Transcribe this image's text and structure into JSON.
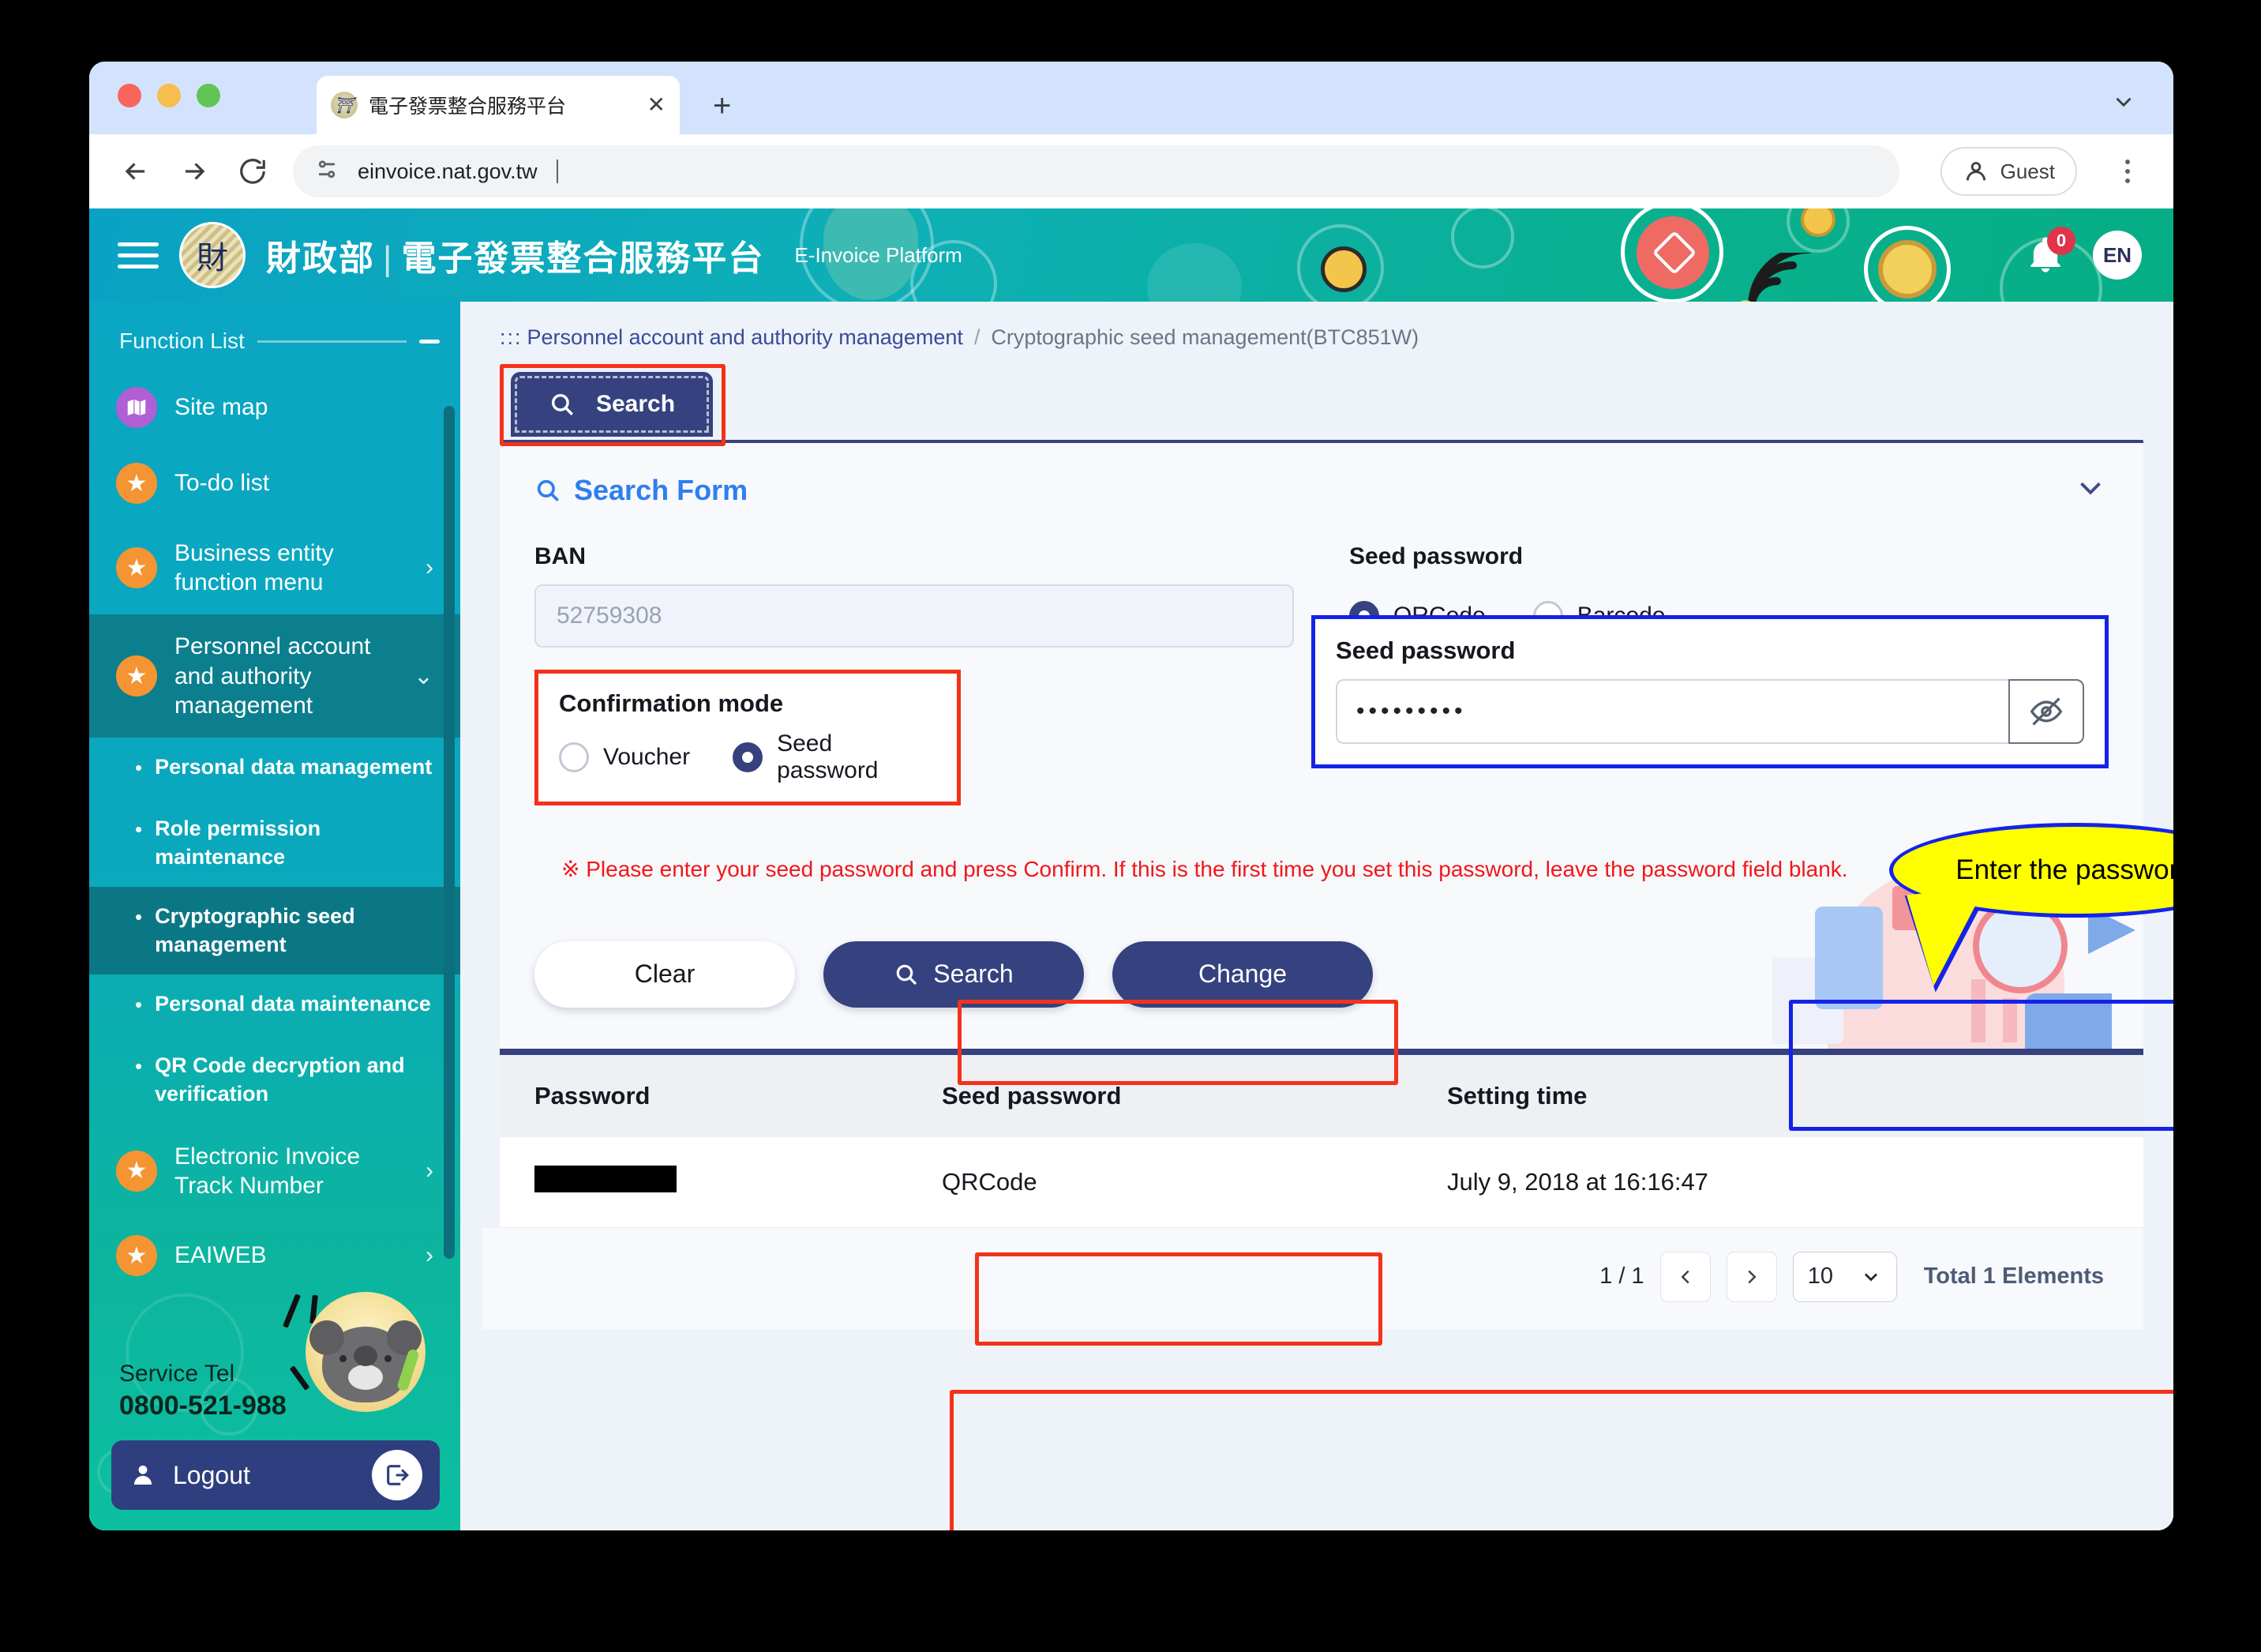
{
  "browser": {
    "tab_title": "電子發票整合服務平台",
    "tab_favicon": "mof-emblem-icon",
    "close_label": "✕",
    "newtab_label": "+",
    "url": "einvoice.nat.gov.tw",
    "guest_label": "Guest"
  },
  "header": {
    "brand_cn_left": "財政部",
    "brand_separator": "|",
    "brand_cn_right": "電子發票整合服務平台",
    "brand_en": "E-Invoice Platform",
    "notification_count": "0",
    "language": "EN"
  },
  "sidebar": {
    "function_list_label": "Function List",
    "items": [
      {
        "label": "Site map",
        "icon": "map-icon",
        "icon_color": "#b05fd4",
        "has_chevron": false
      },
      {
        "label": "To-do list",
        "icon": "star-icon",
        "icon_color": "#f59433",
        "has_chevron": false
      },
      {
        "label": "Business entity function menu",
        "icon": "star-icon",
        "icon_color": "#f59433",
        "has_chevron": true,
        "chevron": "›"
      },
      {
        "label": "Personnel account and authority management",
        "icon": "star-icon",
        "icon_color": "#f59433",
        "has_chevron": true,
        "chevron": "⌄",
        "active": true
      }
    ],
    "subitems": [
      {
        "label": "Personal data management",
        "active": false
      },
      {
        "label": "Role permission maintenance",
        "active": false
      },
      {
        "label": "Cryptographic seed management",
        "active": true
      },
      {
        "label": "Personal data maintenance",
        "active": false
      },
      {
        "label": "QR Code decryption and verification",
        "active": false
      }
    ],
    "items_after": [
      {
        "label": "Electronic Invoice Track Number",
        "icon": "star-icon",
        "icon_color": "#f59433",
        "chevron": "›"
      },
      {
        "label": "EAIWEB",
        "icon": "star-icon",
        "icon_color": "#f59433",
        "chevron": "›"
      }
    ],
    "service_tel_label": "Service Tel",
    "service_tel_number": "0800-521-988",
    "logout_label": "Logout",
    "logout_icon": "logout-icon",
    "avatar_icon": "koala-agent-avatar"
  },
  "breadcrumb": {
    "dots": ":::",
    "parent": "Personnel account and authority management",
    "separator": "/",
    "current": "Cryptographic seed management(BTC851W)"
  },
  "tab": {
    "search_label": "Search",
    "search_icon": "magnifier-icon"
  },
  "panel": {
    "title": "Search Form",
    "title_icon": "magnifier-icon",
    "collapse_icon": "chevron-down-icon"
  },
  "form": {
    "ban_label": "BAN",
    "ban_value": "52759308",
    "seed_password_group_label": "Seed password",
    "seed_password_options": [
      {
        "label": "QRCode",
        "selected": true
      },
      {
        "label": "Barcode",
        "selected": false
      }
    ],
    "confirmation_mode_label": "Confirmation mode",
    "confirmation_mode_options": [
      {
        "label": "Voucher",
        "selected": false
      },
      {
        "label": "Seed password",
        "selected": true
      }
    ],
    "seed_password_box_label": "Seed password",
    "seed_password_value": "•••••••••",
    "toggle_visibility_icon": "eye-slash-icon"
  },
  "callout": {
    "text": "Enter the password",
    "fill": "#ffff00",
    "stroke": "#1423e8"
  },
  "notice": {
    "text": "※ Please enter your seed password and press Confirm. If this is the first time you set this password, leave the password field blank.",
    "color": "#f0171b",
    "close_label": "✕"
  },
  "buttons": {
    "clear": "Clear",
    "search": "Search",
    "change": "Change",
    "search_icon": "magnifier-icon"
  },
  "results": {
    "columns": [
      "Password",
      "Seed password",
      "Setting time"
    ],
    "rows": [
      {
        "password": "",
        "password_redacted": true,
        "seed_password": "QRCode",
        "setting_time": "July 9, 2018 at 16:16:47"
      }
    ]
  },
  "pagination": {
    "page_indicator": "1 / 1",
    "prev_icon": "chevron-left-icon",
    "next_icon": "chevron-right-icon",
    "page_size": "10",
    "page_size_caret": "chevron-down-icon",
    "total_label": "Total 1 Elements"
  },
  "highlights": {
    "red": "#f4321a",
    "blue": "#1423e8"
  }
}
